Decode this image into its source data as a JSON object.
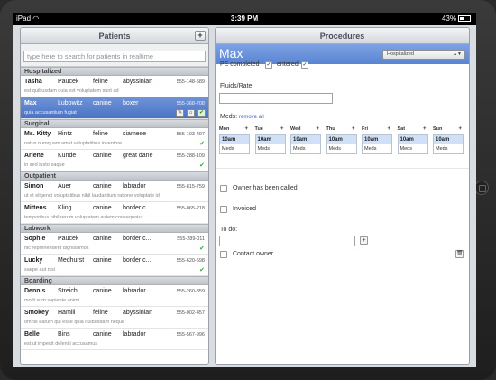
{
  "status_bar": {
    "device": "iPad",
    "time": "3:39 PM",
    "battery": "43%"
  },
  "left": {
    "title": "Patients",
    "add_label": "+",
    "search_placeholder": "type here to search for patients in realtime",
    "groups": [
      {
        "name": "Hospitalized",
        "patients": [
          {
            "name": "Tasha",
            "last": "Paucek",
            "species": "feline",
            "breed": "abyssinian",
            "phone": "555-148-589",
            "sub": "est quibusdam quia est voluptatem sunt ad",
            "check": false,
            "selected": false
          },
          {
            "name": "Max",
            "last": "Lubowitz",
            "species": "canine",
            "breed": "boxer",
            "phone": "555-368-708",
            "sub": "quia accusantium fugiat",
            "check": false,
            "selected": true
          }
        ]
      },
      {
        "name": "Surgical",
        "patients": [
          {
            "name": "Ms. Kitty",
            "last": "Hintz",
            "species": "feline",
            "breed": "siamese",
            "phone": "555-103-497",
            "sub": "natus numquam amet voluptatibus inventore",
            "check": true,
            "selected": false
          },
          {
            "name": "Arlene",
            "last": "Kunde",
            "species": "canine",
            "breed": "great dane",
            "phone": "555-288-109",
            "sub": "in sed iusto eaque",
            "check": true,
            "selected": false
          }
        ]
      },
      {
        "name": "Outpatient",
        "patients": [
          {
            "name": "Simon",
            "last": "Auer",
            "species": "canine",
            "breed": "labrador",
            "phone": "555-815-759",
            "sub": "ut et eligendi voluptatibus nihil laudantium ratione voluptate id",
            "check": false,
            "selected": false
          },
          {
            "name": "Mittens",
            "last": "Kling",
            "species": "canine",
            "breed": "border c...",
            "phone": "555-065-218",
            "sub": "temporibus nihil rerum voluptatem autem consequatur",
            "check": false,
            "selected": false
          }
        ]
      },
      {
        "name": "Labwork",
        "patients": [
          {
            "name": "Sophie",
            "last": "Paucek",
            "species": "canine",
            "breed": "border c...",
            "phone": "555-289-011",
            "sub": "hic reprehenderit dignissimos",
            "check": true,
            "selected": false
          },
          {
            "name": "Lucky",
            "last": "Medhurst",
            "species": "canine",
            "breed": "border c...",
            "phone": "555-620-598",
            "sub": "saepe aut nisi",
            "check": true,
            "selected": false
          }
        ]
      },
      {
        "name": "Boarding",
        "patients": [
          {
            "name": "Dennis",
            "last": "Streich",
            "species": "canine",
            "breed": "labrador",
            "phone": "555-260-359",
            "sub": "modi sum sapiente animi",
            "check": false,
            "selected": false
          },
          {
            "name": "Smokey",
            "last": "Hamill",
            "species": "feline",
            "breed": "abyssinian",
            "phone": "555-002-457",
            "sub": "omnis earum qui esse quia quibusdam neque",
            "check": false,
            "selected": false
          },
          {
            "name": "Belle",
            "last": "Bins",
            "species": "canine",
            "breed": "labrador",
            "phone": "555-567-996",
            "sub": "est ut impedit deleniti accusamus",
            "check": false,
            "selected": false
          }
        ]
      }
    ],
    "row_actions": {
      "edit": "✎",
      "home": "⌂",
      "ok": "✔"
    }
  },
  "right": {
    "title": "Procedures",
    "patient_name": "Max",
    "status": "Hospitalized",
    "pe_completed": "PE completed",
    "entered": "entered",
    "fluids_label": "Fluids/Rate",
    "meds_label": "Meds:",
    "remove_all": "remove all",
    "days": [
      {
        "day": "Mon",
        "time": "10am",
        "med": "Meds"
      },
      {
        "day": "Tue",
        "time": "10am",
        "med": "Meds"
      },
      {
        "day": "Wed",
        "time": "10am",
        "med": "Meds"
      },
      {
        "day": "Thu",
        "time": "10am",
        "med": "Meds"
      },
      {
        "day": "Fri",
        "time": "10am",
        "med": "Meds"
      },
      {
        "day": "Sat",
        "time": "10am",
        "med": "Meds"
      },
      {
        "day": "Sun",
        "time": "10am",
        "med": "Meds"
      }
    ],
    "owner_called": "Owner has been called",
    "invoiced": "Invoiced",
    "todo_label": "To do:",
    "todo_add": "+",
    "contact_owner": "Contact owner"
  }
}
